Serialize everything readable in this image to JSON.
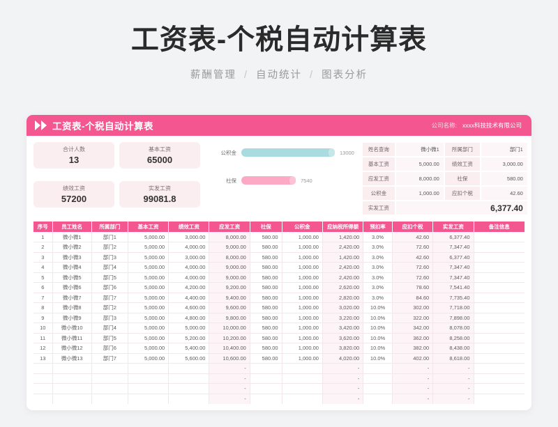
{
  "title": "工资表-个税自动计算表",
  "subtitle": {
    "parts": [
      "薪酬管理",
      "自动统计",
      "图表分析"
    ],
    "separator": "/"
  },
  "header_bar": {
    "title": "工资表-个税自动计算表",
    "icon": "double-triangle-icon",
    "company_label": "公司名称:",
    "company_value": "xxxx科技技术有限公司",
    "color": "#f4568f"
  },
  "summary_cards": [
    {
      "label": "合计人数",
      "value": "13"
    },
    {
      "label": "基本工资",
      "value": "65000"
    },
    {
      "label": "绩效工资",
      "value": "57200"
    },
    {
      "label": "实发工资",
      "value": "99081.8"
    }
  ],
  "chart_data": {
    "type": "bar",
    "orientation": "horizontal",
    "categories": [
      "公积金",
      "社保"
    ],
    "values": [
      13000,
      7540
    ],
    "value_labels": [
      "13000",
      "7540"
    ],
    "colors": [
      "#a9dbe0",
      "#fba9c4"
    ],
    "title": "",
    "xlabel": "",
    "ylabel": "",
    "xlim": [
      0,
      14500
    ],
    "grid": false,
    "legend": "none"
  },
  "query_panel": {
    "rows": [
      {
        "l1": "姓名查询",
        "v1": "微小微1",
        "l2": "所属部门",
        "v2": "部门1"
      },
      {
        "l1": "基本工资",
        "v1": "5,000.00",
        "l2": "绩效工资",
        "v2": "3,000.00"
      },
      {
        "l1": "应发工资",
        "v1": "8,000.00",
        "l2": "社保",
        "v2": "580.00"
      },
      {
        "l1": "公积金",
        "v1": "1,000.00",
        "l2": "应扣个税",
        "v2": "42.60"
      }
    ],
    "total_label": "实发工资",
    "total_value": "6,377.40"
  },
  "table": {
    "columns": [
      "序号",
      "员工姓名",
      "所属部门",
      "基本工资",
      "绩效工资",
      "应发工资",
      "社保",
      "公积金",
      "应纳税所得额",
      "预扣率",
      "应扣个税",
      "实发工资",
      "备注信息"
    ],
    "rows": [
      [
        "1",
        "微小微1",
        "部门1",
        "5,000.00",
        "3,000.00",
        "8,000.00",
        "580.00",
        "1,000.00",
        "1,420.00",
        "3.0%",
        "42.60",
        "6,377.40",
        ""
      ],
      [
        "2",
        "微小微2",
        "部门2",
        "5,000.00",
        "4,000.00",
        "9,000.00",
        "580.00",
        "1,000.00",
        "2,420.00",
        "3.0%",
        "72.60",
        "7,347.40",
        ""
      ],
      [
        "3",
        "微小微3",
        "部门3",
        "5,000.00",
        "3,000.00",
        "8,000.00",
        "580.00",
        "1,000.00",
        "1,420.00",
        "3.0%",
        "42.60",
        "6,377.40",
        ""
      ],
      [
        "4",
        "微小微4",
        "部门4",
        "5,000.00",
        "4,000.00",
        "9,000.00",
        "580.00",
        "1,000.00",
        "2,420.00",
        "3.0%",
        "72.60",
        "7,347.40",
        ""
      ],
      [
        "5",
        "微小微5",
        "部门5",
        "5,000.00",
        "4,000.00",
        "9,000.00",
        "580.00",
        "1,000.00",
        "2,420.00",
        "3.0%",
        "72.60",
        "7,347.40",
        ""
      ],
      [
        "6",
        "微小微6",
        "部门6",
        "5,000.00",
        "4,200.00",
        "9,200.00",
        "580.00",
        "1,000.00",
        "2,620.00",
        "3.0%",
        "78.60",
        "7,541.40",
        ""
      ],
      [
        "7",
        "微小微7",
        "部门7",
        "5,000.00",
        "4,400.00",
        "9,400.00",
        "580.00",
        "1,000.00",
        "2,820.00",
        "3.0%",
        "84.60",
        "7,735.40",
        ""
      ],
      [
        "8",
        "微小微8",
        "部门2",
        "5,000.00",
        "4,600.00",
        "9,600.00",
        "580.00",
        "1,000.00",
        "3,020.00",
        "10.0%",
        "302.00",
        "7,718.00",
        ""
      ],
      [
        "9",
        "微小微9",
        "部门3",
        "5,000.00",
        "4,800.00",
        "9,800.00",
        "580.00",
        "1,000.00",
        "3,220.00",
        "10.0%",
        "322.00",
        "7,898.00",
        ""
      ],
      [
        "10",
        "微小微10",
        "部门4",
        "5,000.00",
        "5,000.00",
        "10,000.00",
        "580.00",
        "1,000.00",
        "3,420.00",
        "10.0%",
        "342.00",
        "8,078.00",
        ""
      ],
      [
        "11",
        "微小微11",
        "部门5",
        "5,000.00",
        "5,200.00",
        "10,200.00",
        "580.00",
        "1,000.00",
        "3,620.00",
        "10.0%",
        "362.00",
        "8,258.00",
        ""
      ],
      [
        "12",
        "微小微12",
        "部门6",
        "5,000.00",
        "5,400.00",
        "10,400.00",
        "580.00",
        "1,000.00",
        "3,820.00",
        "10.0%",
        "382.00",
        "8,438.00",
        ""
      ],
      [
        "13",
        "微小微13",
        "部门7",
        "5,000.00",
        "5,600.00",
        "10,600.00",
        "580.00",
        "1,000.00",
        "4,020.00",
        "10.0%",
        "402.00",
        "8,618.00",
        ""
      ],
      [
        "",
        "",
        "",
        "",
        "",
        "-",
        "",
        "",
        "-",
        "",
        "-",
        "-",
        ""
      ],
      [
        "",
        "",
        "",
        "",
        "",
        "-",
        "",
        "",
        "-",
        "",
        "-",
        "-",
        ""
      ],
      [
        "",
        "",
        "",
        "",
        "",
        "-",
        "",
        "",
        "-",
        "",
        "-",
        "-",
        ""
      ],
      [
        "",
        "",
        "",
        "",
        "",
        "-",
        "",
        "",
        "-",
        "",
        "-",
        "-",
        ""
      ]
    ],
    "tinted_columns": [
      5,
      8,
      10,
      11
    ]
  }
}
